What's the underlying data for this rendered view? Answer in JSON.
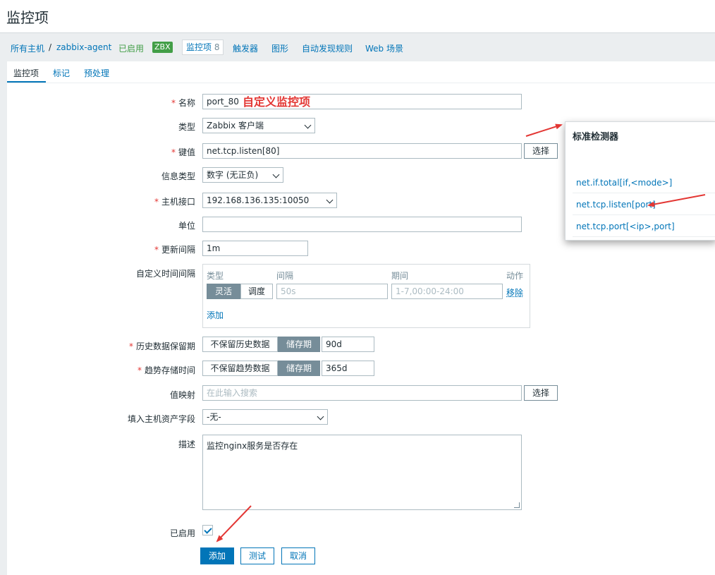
{
  "page": {
    "title": "监控项"
  },
  "breadcrumb": {
    "all_hosts": "所有主机",
    "separator": "/",
    "host": "zabbix-agent",
    "status": "已启用",
    "zbx_badge": "ZBX",
    "items_label": "监控项",
    "items_count": "8",
    "triggers": "触发器",
    "graphs": "图形",
    "discovery": "自动发现规则",
    "web": "Web 场景"
  },
  "tabs": [
    "监控项",
    "标记",
    "预处理"
  ],
  "annotation": "自定义监控项",
  "form": {
    "name": {
      "label": "名称",
      "value": "port_80"
    },
    "type": {
      "label": "类型",
      "value": "Zabbix 客户端"
    },
    "key": {
      "label": "键值",
      "value": "net.tcp.listen[80]",
      "button": "选择"
    },
    "info_type": {
      "label": "信息类型",
      "value": "数字 (无正负)"
    },
    "interface": {
      "label": "主机接口",
      "value": "192.168.136.135:10050"
    },
    "units": {
      "label": "单位",
      "value": ""
    },
    "interval": {
      "label": "更新间隔",
      "value": "1m"
    },
    "custom_intervals": {
      "label": "自定义时间间隔",
      "headers": {
        "type": "类型",
        "interval": "间隔",
        "period": "期间",
        "action": "动作"
      },
      "flexible": "灵活",
      "scheduling": "调度",
      "interval_placeholder": "50s",
      "period_placeholder": "1-7,00:00-24:00",
      "remove": "移除",
      "add": "添加"
    },
    "history": {
      "label": "历史数据保留期",
      "no_keep": "不保留历史数据",
      "storage": "储存期",
      "value": "90d"
    },
    "trends": {
      "label": "趋势存储时间",
      "no_keep": "不保留趋势数据",
      "storage": "储存期",
      "value": "365d"
    },
    "valuemap": {
      "label": "值映射",
      "placeholder": "在此输入搜索",
      "button": "选择"
    },
    "inventory": {
      "label": "填入主机资产字段",
      "value": "-无-"
    },
    "description": {
      "label": "描述",
      "value": "监控nginx服务是否存在"
    },
    "enabled": {
      "label": "已启用",
      "checked": true
    },
    "buttons": {
      "add": "添加",
      "test": "测试",
      "cancel": "取消"
    }
  },
  "popup": {
    "title": "标准检测器",
    "items": [
      "net.if.total[if,<mode>]",
      "net.tcp.listen[port]",
      "net.tcp.port[<ip>,port]"
    ]
  },
  "colors": {
    "link": "#0275b8",
    "enabled": "#429e47",
    "required": "#e33734",
    "annotation": "#e33734"
  }
}
